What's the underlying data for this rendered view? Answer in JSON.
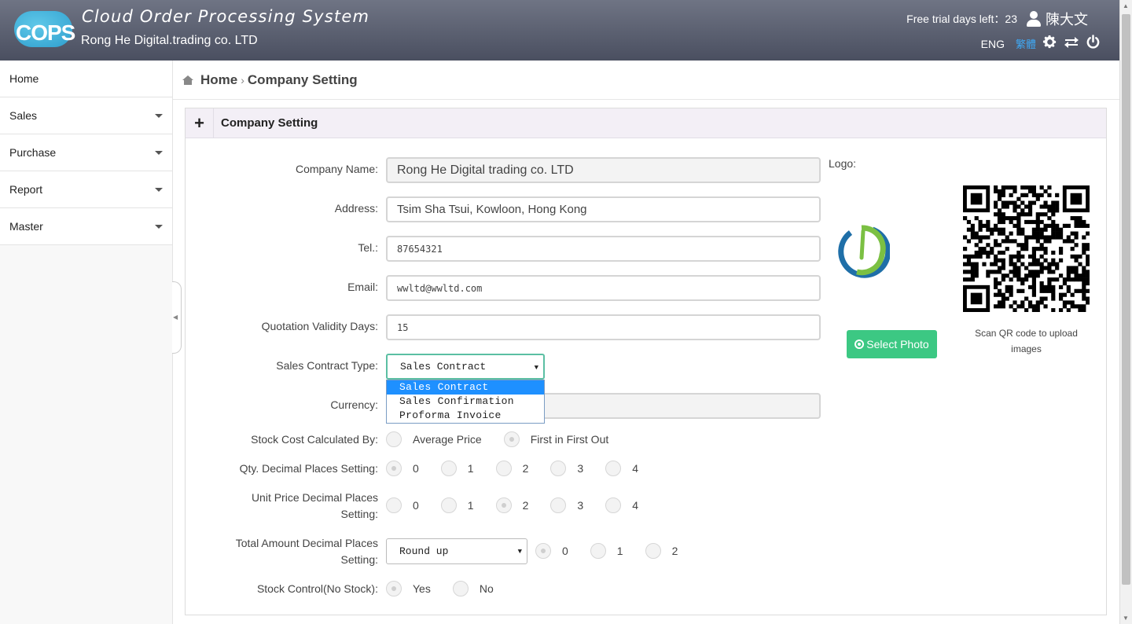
{
  "header": {
    "logo_text": "COPS",
    "app_title": "Cloud Order Processing System",
    "company": "Rong He Digital.trading co. LTD",
    "trial_text": "Free trial days left：23",
    "user_name": "陳大文",
    "lang_eng": "ENG",
    "lang_tc": "繁體",
    "icons": [
      "user-icon",
      "gear-icon",
      "switch-icon",
      "power-icon"
    ]
  },
  "sidebar": {
    "items": [
      {
        "label": "Home",
        "has_caret": false
      },
      {
        "label": "Sales",
        "has_caret": true
      },
      {
        "label": "Purchase",
        "has_caret": true
      },
      {
        "label": "Report",
        "has_caret": true
      },
      {
        "label": "Master",
        "has_caret": true
      }
    ]
  },
  "breadcrumb": {
    "home": "Home",
    "current": "Company Setting"
  },
  "panel": {
    "title": "Company Setting",
    "toggle": "+"
  },
  "form": {
    "company_name": {
      "label": "Company Name:",
      "value": "Rong He Digital trading co. LTD"
    },
    "address": {
      "label": "Address:",
      "value": "Tsim Sha Tsui, Kowloon, Hong Kong"
    },
    "tel": {
      "label": "Tel.:",
      "value": "87654321"
    },
    "email": {
      "label": "Email:",
      "value": "wwltd@wwltd.com"
    },
    "quotation_days": {
      "label": "Quotation Validity Days:",
      "value": "15"
    },
    "sales_contract_type": {
      "label": "Sales Contract Type:",
      "value": "Sales Contract",
      "options": [
        "Sales Contract",
        "Sales Confirmation",
        "Proforma Invoice"
      ]
    },
    "currency": {
      "label": "Currency:",
      "value": ""
    },
    "stock_cost": {
      "label": "Stock Cost Calculated By:",
      "options": [
        "Average Price",
        "First in First Out"
      ],
      "selected": "First in First Out"
    },
    "qty_decimal": {
      "label": "Qty. Decimal Places Setting:",
      "options": [
        "0",
        "1",
        "2",
        "3",
        "4"
      ],
      "selected": "0"
    },
    "unit_price_decimal": {
      "label_line1": "Unit Price Decimal Places",
      "label_line2": "Setting:",
      "options": [
        "0",
        "1",
        "2",
        "3",
        "4"
      ],
      "selected": "2"
    },
    "total_amount_decimal": {
      "label_line1": "Total Amount Decimal Places",
      "label_line2": "Setting:",
      "rounding": "Round up",
      "options": [
        "0",
        "1",
        "2"
      ],
      "selected": "0"
    },
    "stock_control": {
      "label": "Stock Control(No Stock):",
      "options": [
        "Yes",
        "No"
      ],
      "selected": "Yes"
    }
  },
  "logo_section": {
    "label": "Logo:",
    "select_photo": "Select Photo",
    "qr_caption": "Scan QR code to upload images"
  },
  "colors": {
    "header_top": "#6f7484",
    "header_bottom": "#4a4f60",
    "accent_green": "#3cc883",
    "focus_border": "#5bbfa3",
    "dropdown_selected": "#1e90ff",
    "lang_tc": "#3fa9f5"
  }
}
